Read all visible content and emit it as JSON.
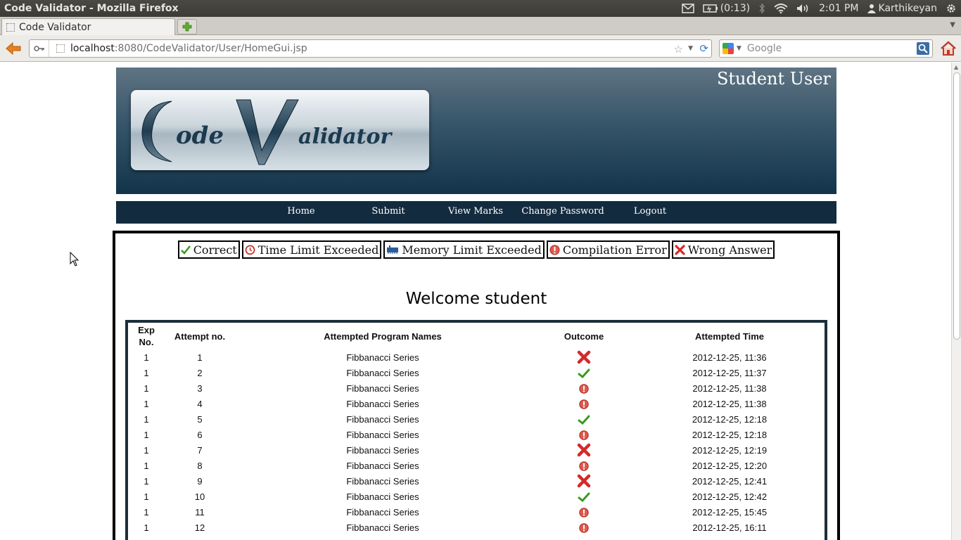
{
  "window": {
    "title": "Code Validator - Mozilla Firefox"
  },
  "system_tray": {
    "battery": "(0:13)",
    "clock": "2:01 PM",
    "user": "Karthikeyan"
  },
  "browser": {
    "tab_title": "Code Validator",
    "url_host": "localhost",
    "url_rest": ":8080/CodeValidator/User/HomeGui.jsp",
    "search_placeholder": "Google"
  },
  "header": {
    "user_label": "Student User",
    "logo_text": "Code Validator"
  },
  "menu": [
    "Home",
    "Submit",
    "View Marks",
    "Change Password",
    "Logout"
  ],
  "legend": [
    {
      "label": "Correct",
      "icon": "check-icon"
    },
    {
      "label": "Time Limit Exceeded",
      "icon": "clock-icon"
    },
    {
      "label": "Memory Limit Exceeded",
      "icon": "memory-icon"
    },
    {
      "label": "Compilation Error",
      "icon": "error-icon"
    },
    {
      "label": "Wrong Answer",
      "icon": "cross-icon"
    }
  ],
  "welcome": "Welcome student",
  "table": {
    "headers": {
      "exp_line1": "Exp",
      "exp_line2": "No.",
      "attempt": "Attempt no.",
      "program": "Attempted Program Names",
      "outcome": "Outcome",
      "time": "Attempted Time"
    },
    "rows": [
      {
        "exp": "1",
        "attempt": "1",
        "program": "Fibbanacci Series",
        "outcome": "wrong",
        "time": "2012-12-25, 11:36"
      },
      {
        "exp": "1",
        "attempt": "2",
        "program": "Fibbanacci Series",
        "outcome": "correct",
        "time": "2012-12-25, 11:37"
      },
      {
        "exp": "1",
        "attempt": "3",
        "program": "Fibbanacci Series",
        "outcome": "error",
        "time": "2012-12-25, 11:38"
      },
      {
        "exp": "1",
        "attempt": "4",
        "program": "Fibbanacci Series",
        "outcome": "error",
        "time": "2012-12-25, 11:38"
      },
      {
        "exp": "1",
        "attempt": "5",
        "program": "Fibbanacci Series",
        "outcome": "correct",
        "time": "2012-12-25, 12:18"
      },
      {
        "exp": "1",
        "attempt": "6",
        "program": "Fibbanacci Series",
        "outcome": "error",
        "time": "2012-12-25, 12:18"
      },
      {
        "exp": "1",
        "attempt": "7",
        "program": "Fibbanacci Series",
        "outcome": "wrong",
        "time": "2012-12-25, 12:19"
      },
      {
        "exp": "1",
        "attempt": "8",
        "program": "Fibbanacci Series",
        "outcome": "error",
        "time": "2012-12-25, 12:20"
      },
      {
        "exp": "1",
        "attempt": "9",
        "program": "Fibbanacci Series",
        "outcome": "wrong",
        "time": "2012-12-25, 12:41"
      },
      {
        "exp": "1",
        "attempt": "10",
        "program": "Fibbanacci Series",
        "outcome": "correct",
        "time": "2012-12-25, 12:42"
      },
      {
        "exp": "1",
        "attempt": "11",
        "program": "Fibbanacci Series",
        "outcome": "error",
        "time": "2012-12-25, 15:45"
      },
      {
        "exp": "1",
        "attempt": "12",
        "program": "Fibbanacci Series",
        "outcome": "error",
        "time": "2012-12-25, 16:11"
      }
    ]
  }
}
